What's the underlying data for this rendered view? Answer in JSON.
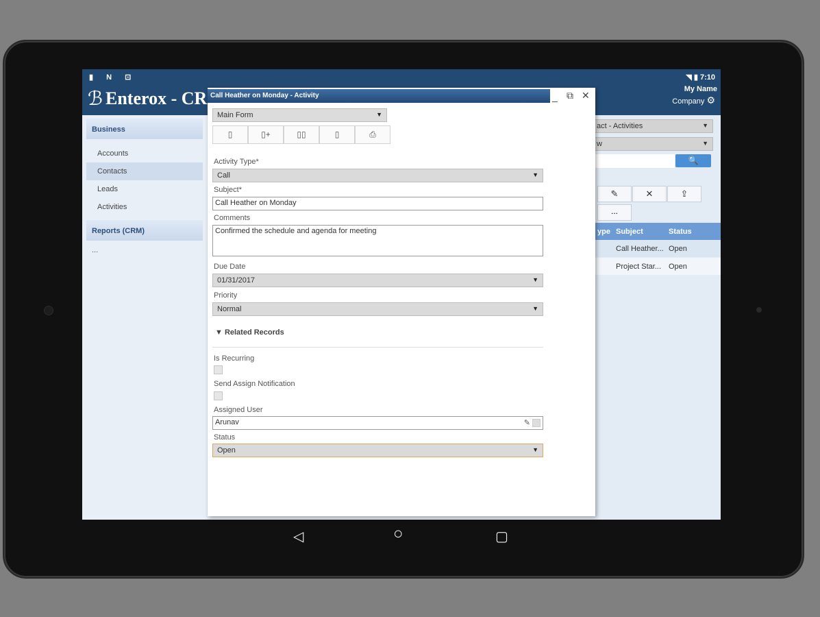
{
  "status_bar": {
    "left_icons": "▮ N ⊡",
    "time": "7:10",
    "right_icons": "◥ ▮"
  },
  "app": {
    "title": "Enterox - CR",
    "user_name": "My Name",
    "company": "Company",
    "gear_icon": "⚙"
  },
  "sidebar": {
    "sections": [
      {
        "label": "Business",
        "items": [
          "Accounts",
          "Contacts",
          "Leads",
          "Activities"
        ],
        "active": "Contacts"
      },
      {
        "label": "Reports (CRM)"
      }
    ],
    "more": "..."
  },
  "right_panel": {
    "view_select": "act - Activities",
    "filter_select": "w",
    "search_icon": "🔍",
    "toolbar": [
      "✎",
      "✕",
      "⇪",
      "..."
    ],
    "columns": [
      "ype",
      "Subject",
      "Status"
    ],
    "rows": [
      {
        "subject": "Call Heather...",
        "status": "Open"
      },
      {
        "subject": "Project Star...",
        "status": "Open"
      }
    ]
  },
  "modal": {
    "title": "Call Heather on Monday - Activity",
    "form_select": "Main Form",
    "toolbar_icons": [
      "▯",
      "▯+",
      "▯▯",
      "▯",
      "⎙"
    ],
    "fields": {
      "activity_type": {
        "label": "Activity Type*",
        "value": "Call"
      },
      "subject": {
        "label": "Subject*",
        "value": "Call Heather on Monday"
      },
      "comments": {
        "label": "Comments",
        "value": "Confirmed the schedule and agenda for meeting"
      },
      "due_date": {
        "label": "Due Date",
        "value": "01/31/2017"
      },
      "priority": {
        "label": "Priority",
        "value": "Normal"
      },
      "is_recurring": {
        "label": "Is Recurring",
        "checked": false
      },
      "send_notification": {
        "label": "Send Assign Notification",
        "checked": false
      },
      "assigned_user": {
        "label": "Assigned User",
        "value": "Arunav"
      },
      "status": {
        "label": "Status",
        "value": "Open"
      }
    },
    "related_records": "▼ Related Records"
  },
  "android_nav": {
    "back": "◁",
    "home": "○",
    "recents": "▢"
  },
  "colors": {
    "header": "#234a73",
    "modal_title": "#2d5a8c",
    "grid_header": "#6d9bd6",
    "search_button": "#4a8fd6"
  }
}
